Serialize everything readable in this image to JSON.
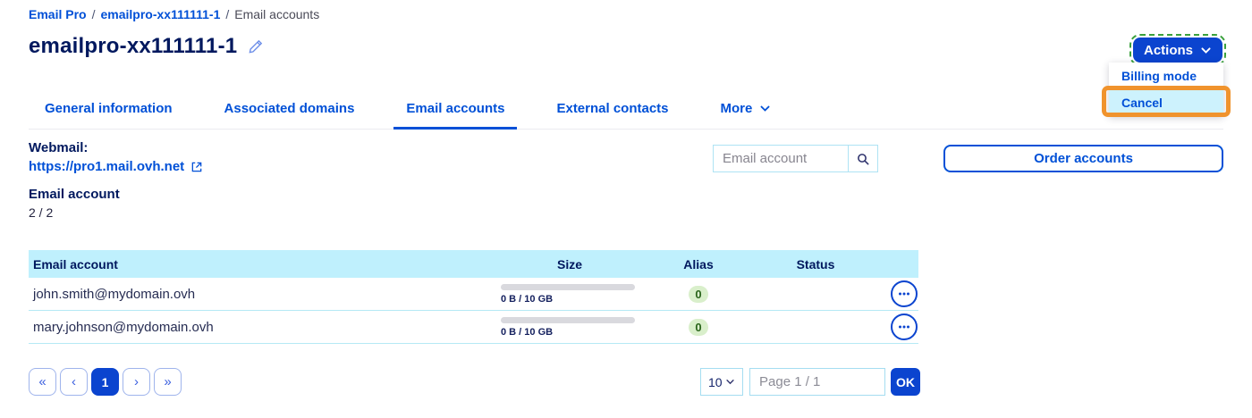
{
  "breadcrumb": {
    "separator": "/",
    "items": [
      {
        "label": "Email Pro"
      },
      {
        "label": "emailpro-xx111111-1"
      },
      {
        "label": "Email accounts"
      }
    ]
  },
  "header": {
    "title": "emailpro-xx111111-1",
    "actions_button": "Actions"
  },
  "actions_menu": {
    "items": [
      {
        "label": "Billing mode"
      },
      {
        "label": "Cancel",
        "highlighted": true
      }
    ]
  },
  "tabs": {
    "active": "Email accounts",
    "items": [
      {
        "label": "General information"
      },
      {
        "label": "Associated domains"
      },
      {
        "label": "Email accounts"
      },
      {
        "label": "External contacts"
      },
      {
        "label": "More"
      }
    ]
  },
  "summary": {
    "webmail_label": "Webmail:",
    "webmail_url": "https://pro1.mail.ovh.net",
    "account_label": "Email account",
    "account_count": "2 / 2"
  },
  "toolbar": {
    "search_placeholder": "Email account",
    "order_button": "Order accounts"
  },
  "table": {
    "headers": {
      "email": "Email account",
      "size": "Size",
      "alias": "Alias",
      "status": "Status"
    },
    "rows": [
      {
        "email": "john.smith@mydomain.ovh",
        "size": "0 B / 10 GB",
        "usage_percent": 0,
        "alias": "0",
        "status": ""
      },
      {
        "email": "mary.johnson@mydomain.ovh",
        "size": "0 B / 10 GB",
        "usage_percent": 0,
        "alias": "0",
        "status": ""
      }
    ]
  },
  "pagination": {
    "first": "«",
    "prev": "‹",
    "current_page": "1",
    "next": "›",
    "last": "»",
    "page_size": "10",
    "page_field": "Page 1 / 1",
    "ok_button": "OK"
  },
  "icons": {
    "edit": "pencil-icon",
    "chevron_down": "chevron-down-icon",
    "external_link": "external-link-icon",
    "search": "search-icon",
    "row_actions": "ellipsis-icon"
  },
  "colors": {
    "primary_blue": "#0050d7",
    "button_blue": "#0b44cf",
    "heading_navy": "#00185e",
    "table_header_bg": "#bff0fd",
    "row_divider": "#b5e9f5",
    "menu_highlight_bg": "#cdf2fd",
    "annotation_orange": "#f0932d",
    "focus_outline_green": "#3ba13d",
    "badge_green_bg": "#d9efcb",
    "badge_green_text": "#29641a",
    "progress_track": "#d9d9de"
  }
}
